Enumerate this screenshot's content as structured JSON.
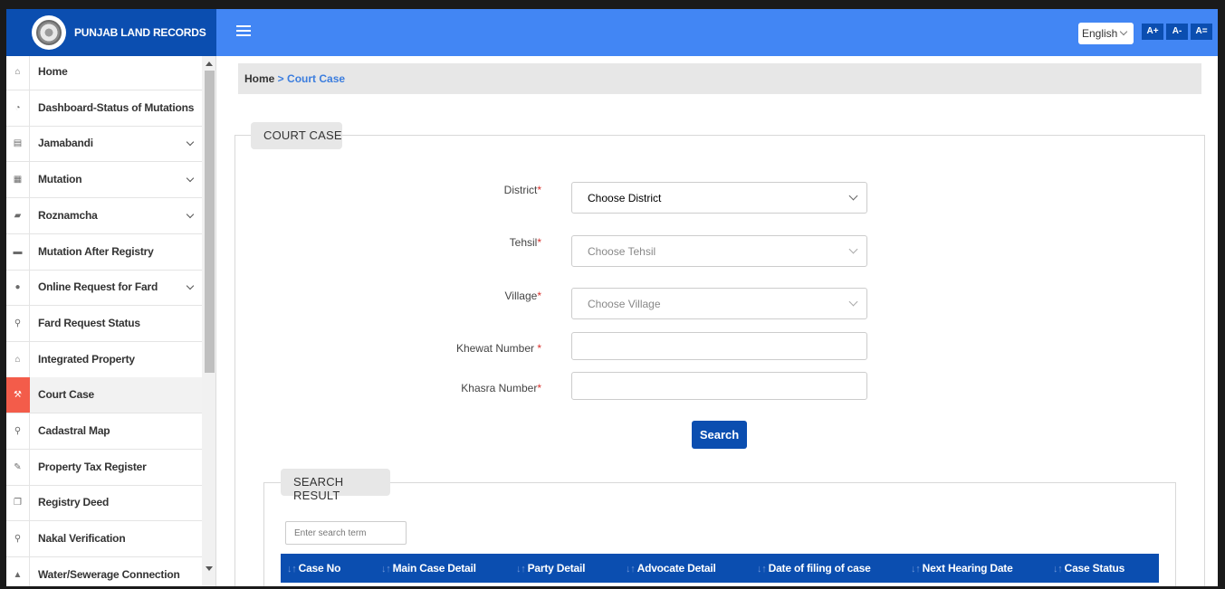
{
  "header": {
    "brand_title": "PUNJAB LAND RECORDS",
    "language": "English",
    "font_increase": "A+",
    "font_decrease": "A-",
    "font_reset": "A="
  },
  "sidebar": {
    "items": [
      {
        "label": "Home",
        "icon": "home-icon",
        "glyph": "⌂",
        "has_submenu": false,
        "active": false
      },
      {
        "label": "Dashboard-Status of Mutations",
        "icon": "dashboard-icon",
        "glyph": "◔",
        "has_submenu": false,
        "active": false
      },
      {
        "label": "Jamabandi",
        "icon": "id-card-icon",
        "glyph": "▤",
        "has_submenu": true,
        "active": false
      },
      {
        "label": "Mutation",
        "icon": "document-icon",
        "glyph": "▦",
        "has_submenu": true,
        "active": false
      },
      {
        "label": "Roznamcha",
        "icon": "book-icon",
        "glyph": "▰",
        "has_submenu": true,
        "active": false
      },
      {
        "label": "Mutation After Registry",
        "icon": "briefcase-icon",
        "glyph": "▬",
        "has_submenu": false,
        "active": false
      },
      {
        "label": "Online Request for Fard",
        "icon": "drop-icon",
        "glyph": "●",
        "has_submenu": true,
        "active": false
      },
      {
        "label": "Fard Request Status",
        "icon": "search-icon",
        "glyph": "⚲",
        "has_submenu": false,
        "active": false
      },
      {
        "label": "Integrated Property",
        "icon": "bank-icon",
        "glyph": "⌂",
        "has_submenu": false,
        "active": false
      },
      {
        "label": "Court Case",
        "icon": "gavel-icon",
        "glyph": "⚒",
        "has_submenu": false,
        "active": true
      },
      {
        "label": "Cadastral Map",
        "icon": "map-marker-icon",
        "glyph": "⚲",
        "has_submenu": false,
        "active": false
      },
      {
        "label": "Property Tax Register",
        "icon": "edit-icon",
        "glyph": "✎",
        "has_submenu": false,
        "active": false
      },
      {
        "label": "Registry Deed",
        "icon": "copy-icon",
        "glyph": "❐",
        "has_submenu": false,
        "active": false
      },
      {
        "label": "Nakal Verification",
        "icon": "search-icon",
        "glyph": "⚲",
        "has_submenu": false,
        "active": false
      },
      {
        "label": "Water/Sewerage Connection",
        "icon": "warning-icon",
        "glyph": "▲",
        "has_submenu": false,
        "active": false
      }
    ]
  },
  "breadcrumb": {
    "home": "Home",
    "separator": " > ",
    "current": "Court Case"
  },
  "court_case": {
    "legend": "COURT CASE",
    "district_label": "District",
    "district_value": "Choose District",
    "tehsil_label": "Tehsil",
    "tehsil_value": "Choose Tehsil",
    "village_label": "Village",
    "village_value": "Choose Village",
    "khewat_label": "Khewat Number ",
    "khasra_label": "Khasra Number",
    "required_mark": "*",
    "search_button": "Search"
  },
  "search_result": {
    "legend": "SEARCH RESULT",
    "search_placeholder": "Enter search term",
    "sort_glyph": "↓↑",
    "columns": [
      "Case No",
      "Main Case Detail",
      "Party Detail",
      "Advocate Detail",
      "Date of filing of case",
      "Next Hearing Date",
      "Case Status"
    ]
  },
  "colors": {
    "brand_blue": "#0b4eb0",
    "topbar_blue": "#4286f4",
    "active_icon_bg": "#f35c4a",
    "link_blue": "#3b7dde",
    "required_red": "#d9302c"
  }
}
